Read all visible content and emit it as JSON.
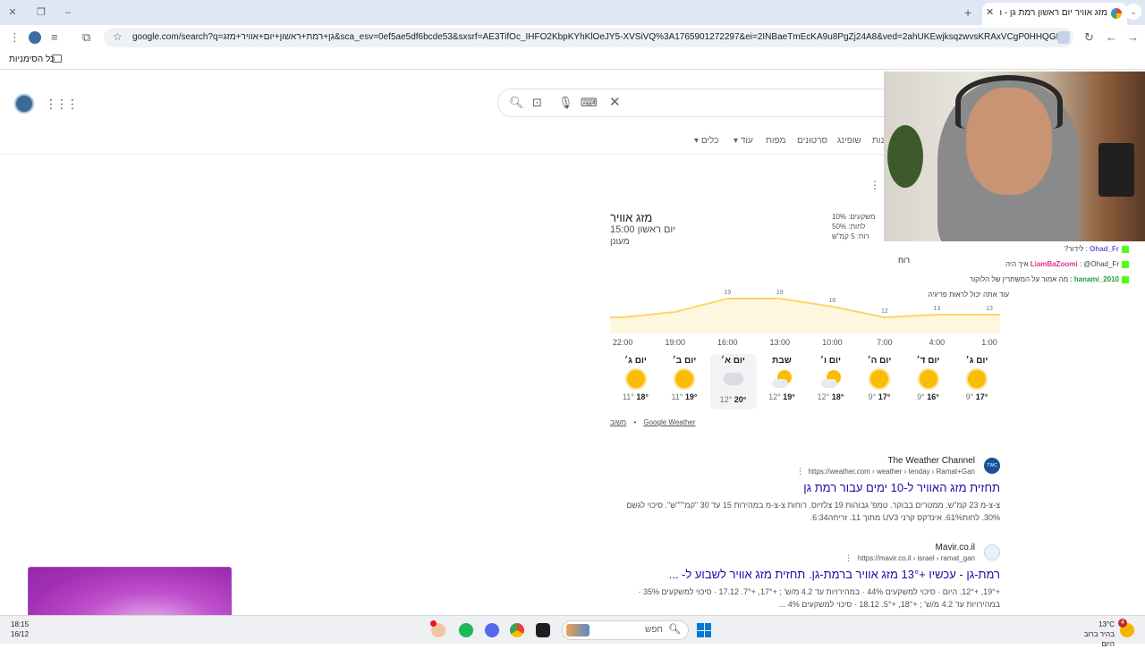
{
  "browser": {
    "tab_title": "מזג אוויר יום ראשון רמת גן - חיפ",
    "url": "google.com/search?q=גן+רמת+ראשון+יום+אוויר+מזג&sca_esv=0ef5ae5df6bcde53&sxsrf=AE3TifOc_IHFO2KbpKYhKlOeJY5-XVSiVQ%3A1765901272297&ei=2INBaeTmEcKA9u8PgZj24A8&ved=2ahUKEwjksqzwvsKRAxVCgP0HHQGMHfwQ4dUDegQIB...",
    "bookmarks_label": "כל הסימניות"
  },
  "search": {
    "tabs": [
      "סרטונים",
      "מפות",
      "שופינג",
      "ונות"
    ],
    "more_label": "עוד",
    "tools_label": "כלים"
  },
  "weather": {
    "title": "מזג אוויר",
    "time": "יום ראשון 15:00",
    "condition": "מעונן",
    "stats": [
      "משקעים: 10%",
      "לחות: 50%",
      "רוח: 5 קמ\"ש"
    ],
    "wind_tab": "רוח",
    "chart_data": {
      "type": "area",
      "x": [
        "1:00",
        "4:00",
        "7:00",
        "10:00",
        "13:00",
        "16:00",
        "19:00",
        "22:00"
      ],
      "values": [
        13,
        13,
        12,
        16,
        19,
        19,
        14,
        12
      ],
      "labels": [
        "13",
        "13",
        "12",
        "16",
        "19",
        "19",
        "",
        ""
      ],
      "color": "#fdd663"
    },
    "days": [
      {
        "name": "יום ג׳",
        "icon": "sun-icon",
        "high": "17°",
        "low": "9°"
      },
      {
        "name": "יום ד׳",
        "icon": "sun-icon",
        "high": "16°",
        "low": "9°"
      },
      {
        "name": "יום ה׳",
        "icon": "sun-icon",
        "high": "17°",
        "low": "9°"
      },
      {
        "name": "יום ו׳",
        "icon": "partly-cloudy-icon",
        "high": "18°",
        "low": "12°"
      },
      {
        "name": "שבת",
        "icon": "partly-cloudy-icon",
        "high": "19°",
        "low": "12°"
      },
      {
        "name": "יום א׳",
        "icon": "cloud-icon",
        "high": "20°",
        "low": "12°"
      },
      {
        "name": "יום ב׳",
        "icon": "sun-icon",
        "high": "19°",
        "low": "11°"
      },
      {
        "name": "יום ג׳",
        "icon": "sun-icon",
        "high": "18°",
        "low": "11°"
      }
    ],
    "source": "Google Weather",
    "feedback": "משוב"
  },
  "results": [
    {
      "site": "The Weather Channel",
      "cite": "https://weather.com › weather › tenday › Ramat+Gan",
      "title": "תחזית מזג האוויר ל-10 ימים עבור רמת גן",
      "snippet1": "צ-צ-מ 23 קמ\"ש. ממטרים בבוקר. טמפ' גבוהות 19 צלזיוס. רוחות צ-צ-מ במהירות 15 עד 30 \"קמ\"\"\"ש\". סיכוי לגשם",
      "snippet2": "30%. לחות61%. אינדקס קרני UV3 מתוך 11. זריחה6:34."
    },
    {
      "site": "Mavir.co.il",
      "cite": "https://mavir.co.il › israel › ramat_gan",
      "title": "רמת-גן - עכשיו +13° מזג אוויר ברמת-גן. תחזית מזג אוויר לשבוע ל- ...",
      "snippet1": "+19°, +12°. היום · סיכוי למשקעים 44% · במהירויות עד 4.2 מ/ש' ; +17°, +7°. 17.12 · סיכוי למשקעים 35% ·",
      "snippet2": "במהירויות עד 4.2 מ/ש' ; +18°, +5°. 18.12 · סיכוי למשקעים 4% ..."
    }
  ],
  "chat": [
    {
      "user": "Ohad_Fr",
      "msg": "לידור?"
    },
    {
      "user": "LiamBaZoomi",
      "msg": "@Ohad_Fr איך היה"
    },
    {
      "user": "hanami_2010",
      "msg": "מה אמור על המשתרין של הלוקור"
    },
    {
      "user": "",
      "msg": "עוד אתה יכול לראות פריגיה"
    }
  ],
  "taskbar": {
    "weather_temp": "13°C",
    "weather_desc": "בהיר ברוב היום",
    "search_placeholder": "חפש",
    "clock_time": "18:15",
    "clock_date": "16/12",
    "notif_count": "4"
  }
}
